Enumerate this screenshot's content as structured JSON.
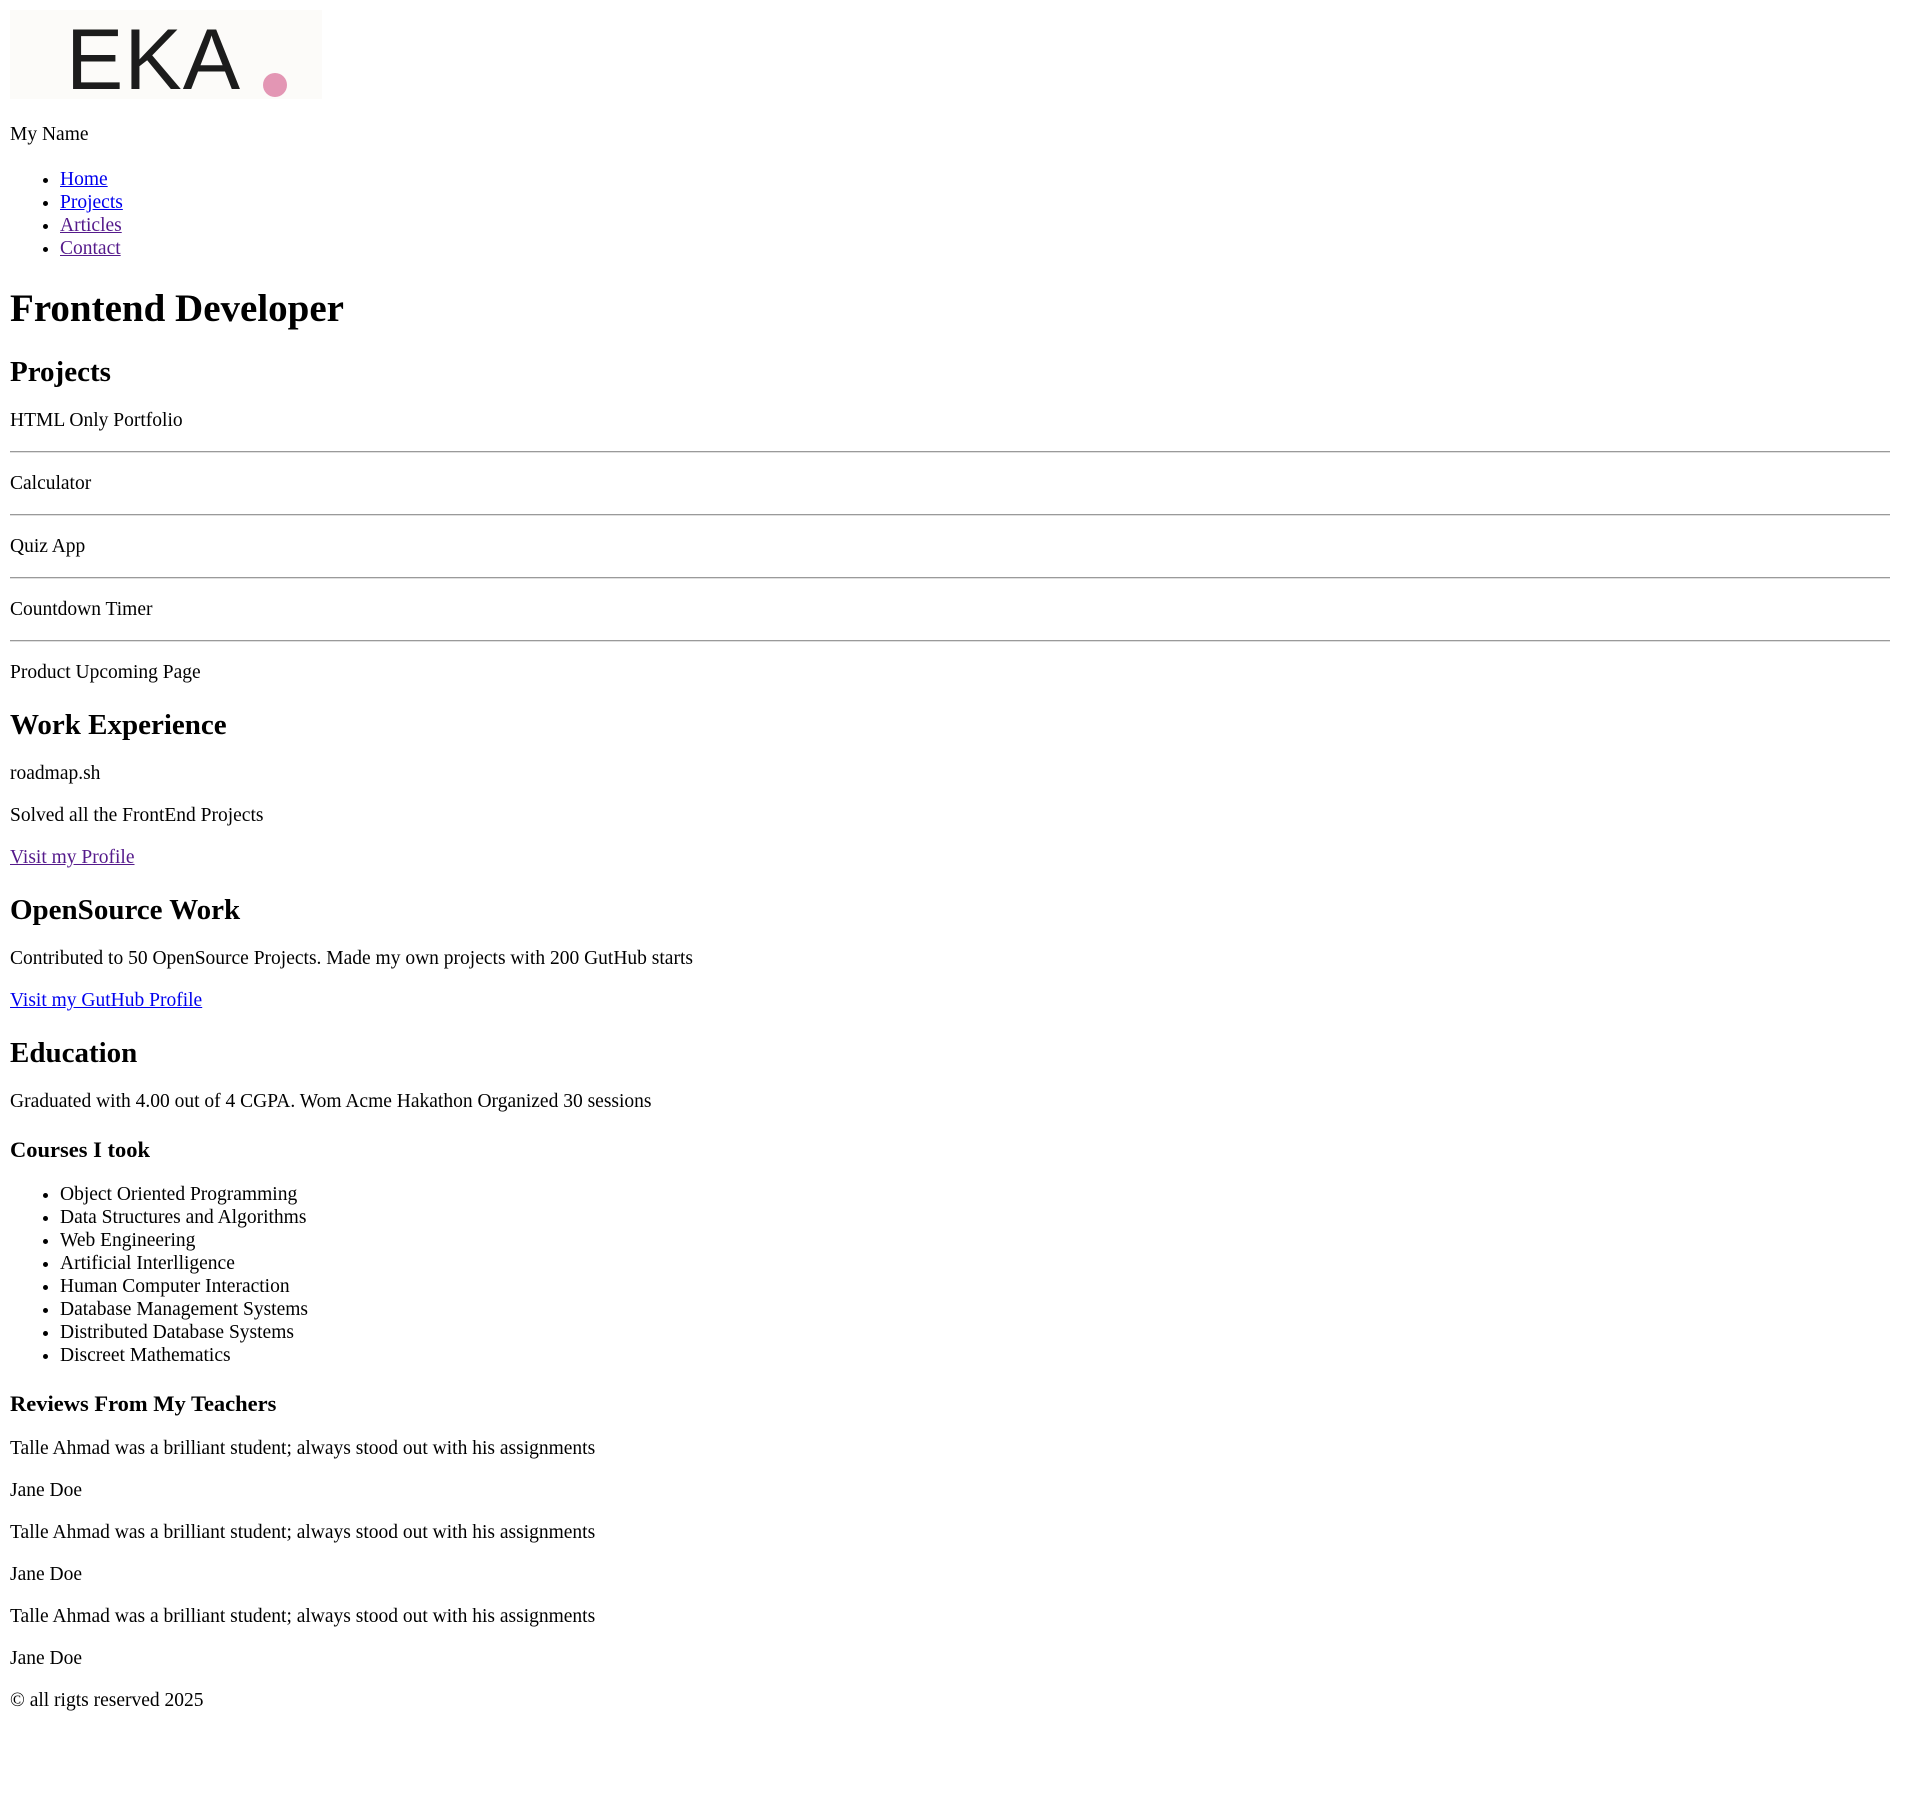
{
  "header": {
    "logo_text": "EKA",
    "logo_dot_color": "#e396b4",
    "name": "My Name",
    "nav": [
      {
        "label": "Home"
      },
      {
        "label": "Projects"
      },
      {
        "label": "Articles"
      },
      {
        "label": "Contact"
      }
    ]
  },
  "main": {
    "title": "Frontend Developer",
    "projects": {
      "heading": "Projects",
      "items": [
        "HTML Only Portfolio",
        "Calculator",
        "Quiz App",
        "Countdown Timer",
        "Product Upcoming Page"
      ]
    },
    "work": {
      "heading": "Work Experience",
      "company": "roadmap.sh",
      "description": "Solved all the FrontEnd Projects",
      "link": "Visit my Profile"
    },
    "opensource": {
      "heading": "OpenSource Work",
      "description": "Contributed to 50 OpenSource Projects. Made my own projects with 200 GutHub starts",
      "link": "Visit my GutHub Profile"
    },
    "education": {
      "heading": "Education",
      "description": "Graduated with 4.00 out of 4 CGPA. Wom Acme Hakathon Organized 30 sessions",
      "courses_heading": "Courses I took",
      "courses": [
        "Object Oriented Programming",
        "Data Structures and Algorithms",
        "Web Engineering",
        "Artificial Interlligence",
        "Human Computer Interaction",
        "Database Management Systems",
        "Distributed Database Systems",
        "Discreet Mathematics"
      ],
      "reviews_heading": "Reviews From My Teachers",
      "reviews": [
        {
          "text": "Talle Ahmad was a brilliant student; always stood out with his assignments",
          "author": "Jane Doe"
        },
        {
          "text": "Talle Ahmad was a brilliant student; always stood out with his assignments",
          "author": "Jane Doe"
        },
        {
          "text": "Talle Ahmad was a brilliant student; always stood out with his assignments",
          "author": "Jane Doe"
        }
      ]
    }
  },
  "footer": {
    "copyright": "© all rigts reserved 2025"
  }
}
